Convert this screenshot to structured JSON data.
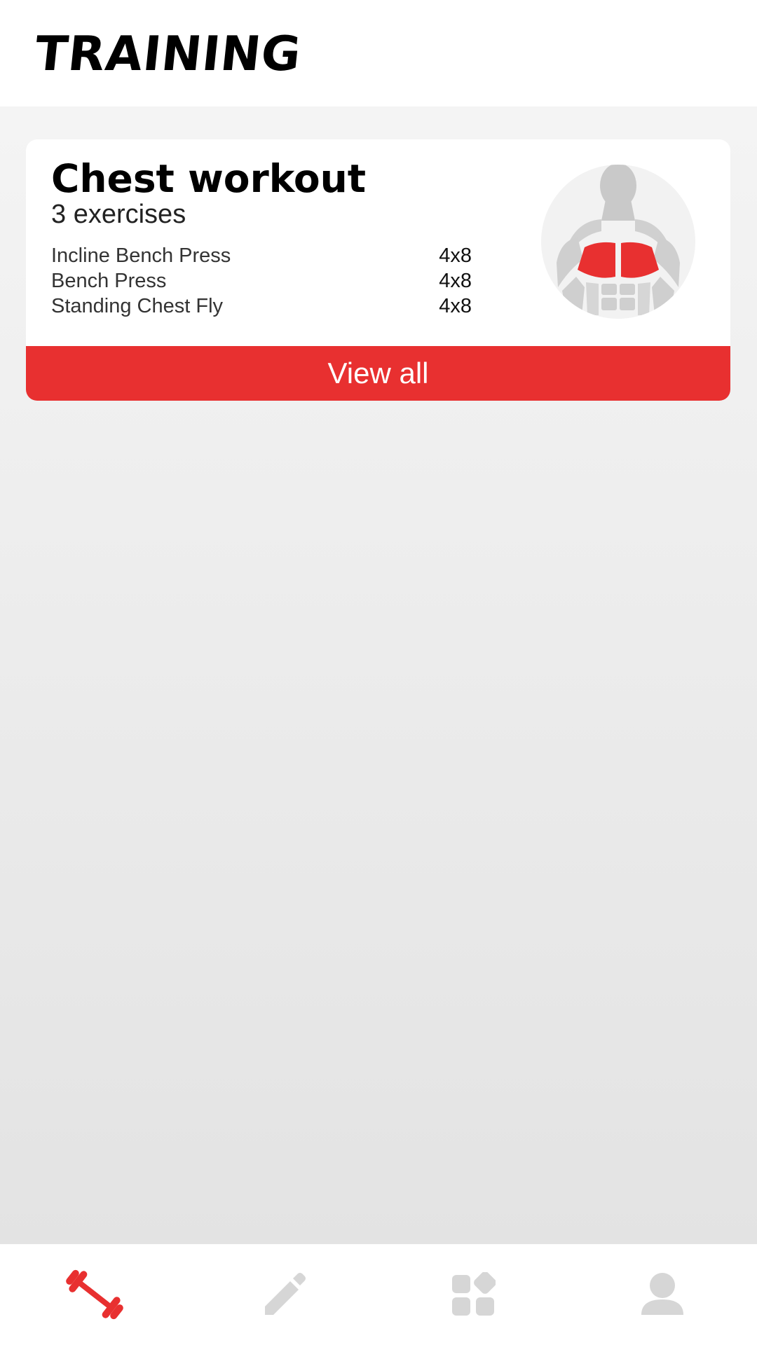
{
  "header": {
    "title": "TRAINING"
  },
  "card": {
    "title": "Chest workout",
    "subtitle": "3 exercises",
    "exercises": [
      {
        "name": "Incline Bench Press",
        "sets": "4x8"
      },
      {
        "name": "Bench Press",
        "sets": "4x8"
      },
      {
        "name": "Standing Chest Fly",
        "sets": "4x8"
      }
    ],
    "image_icon": "chest-muscles-icon",
    "button_label": "View all"
  },
  "tabbar": {
    "items": [
      {
        "icon": "dumbbell-icon",
        "active": true
      },
      {
        "icon": "pencil-icon",
        "active": false
      },
      {
        "icon": "apps-grid-icon",
        "active": false
      },
      {
        "icon": "profile-icon",
        "active": false
      }
    ]
  },
  "colors": {
    "accent": "#e83030",
    "inactive_icon": "#d6d6d6",
    "background": "#eeeeee"
  }
}
